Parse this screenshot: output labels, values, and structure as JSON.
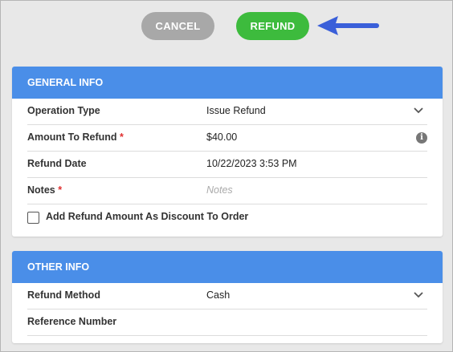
{
  "toolbar": {
    "cancel_label": "CANCEL",
    "refund_label": "REFUND"
  },
  "general_info": {
    "title": "GENERAL INFO",
    "operation_type": {
      "label": "Operation Type",
      "value": "Issue Refund"
    },
    "amount_to_refund": {
      "label": "Amount To Refund",
      "required": "*",
      "value": "$40.00"
    },
    "refund_date": {
      "label": "Refund Date",
      "value": "10/22/2023 3:53 PM"
    },
    "notes": {
      "label": "Notes",
      "required": "*",
      "placeholder": "Notes"
    },
    "add_discount": {
      "label": "Add Refund Amount As Discount To Order",
      "checked": false
    }
  },
  "other_info": {
    "title": "OTHER INFO",
    "refund_method": {
      "label": "Refund Method",
      "value": "Cash"
    },
    "reference_number": {
      "label": "Reference Number",
      "value": ""
    }
  },
  "colors": {
    "header_blue": "#4a8ee8",
    "refund_green": "#3dbb3d",
    "cancel_gray": "#a8a8a8",
    "arrow_blue": "#3a5fd9"
  }
}
